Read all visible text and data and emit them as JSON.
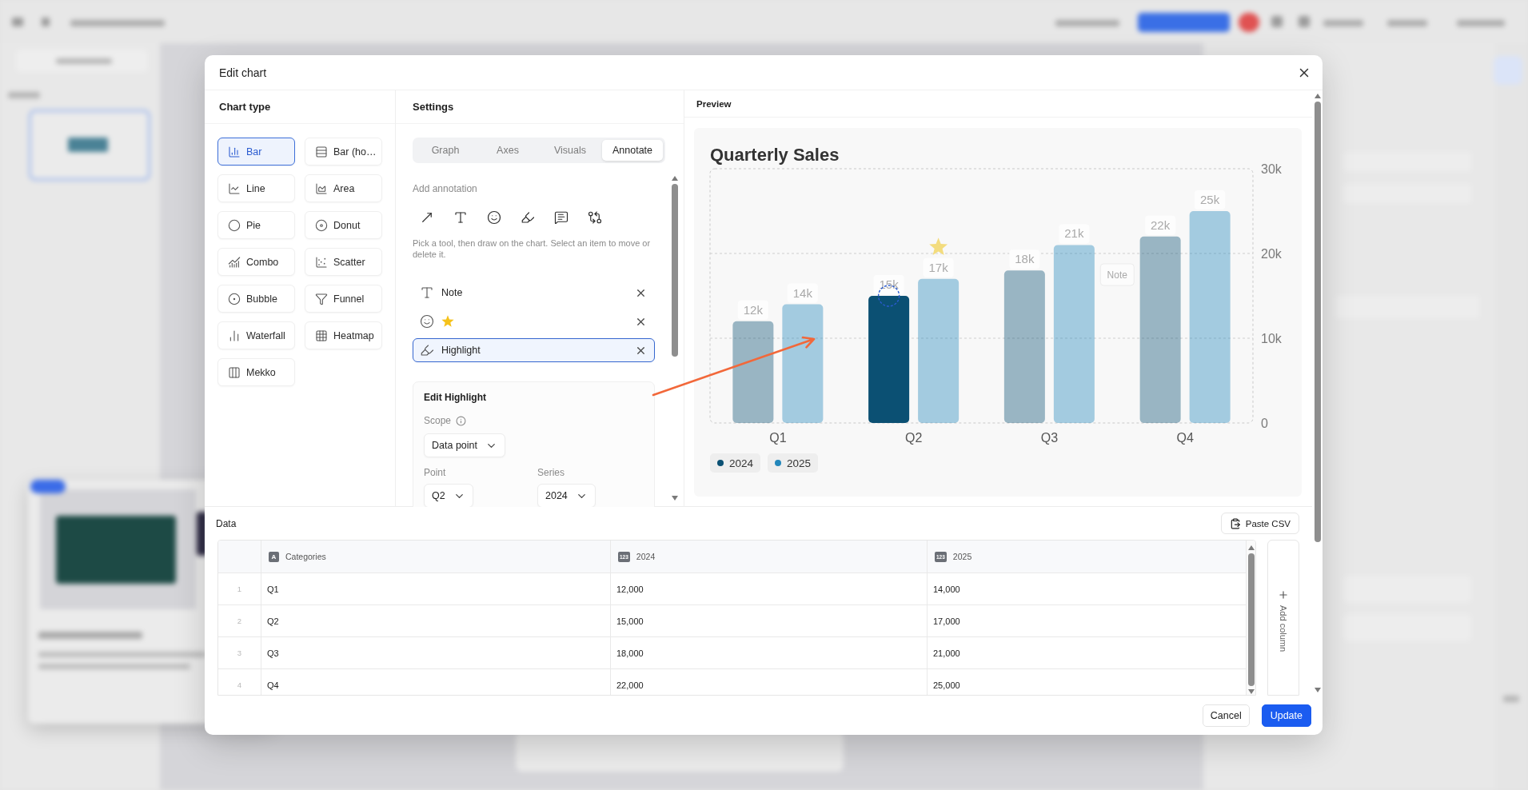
{
  "dialog": {
    "title": "Edit chart"
  },
  "chart_type": {
    "heading": "Chart type",
    "items": [
      {
        "label": "Bar",
        "selected": true
      },
      {
        "label": "Bar (ho…",
        "selected": false
      },
      {
        "label": "Line",
        "selected": false
      },
      {
        "label": "Area",
        "selected": false
      },
      {
        "label": "Pie",
        "selected": false
      },
      {
        "label": "Donut",
        "selected": false
      },
      {
        "label": "Combo",
        "selected": false
      },
      {
        "label": "Scatter",
        "selected": false
      },
      {
        "label": "Bubble",
        "selected": false
      },
      {
        "label": "Funnel",
        "selected": false
      },
      {
        "label": "Waterfall",
        "selected": false
      },
      {
        "label": "Heatmap",
        "selected": false
      },
      {
        "label": "Mekko",
        "selected": false
      }
    ]
  },
  "settings": {
    "heading": "Settings",
    "tabs": [
      {
        "label": "Graph",
        "selected": false
      },
      {
        "label": "Axes",
        "selected": false
      },
      {
        "label": "Visuals",
        "selected": false
      },
      {
        "label": "Annotate",
        "selected": true
      }
    ],
    "add_annotation": "Add annotation",
    "hint": "Pick a tool, then draw on the chart. Select an item to move or delete it.",
    "annotations": [
      {
        "kind": "text",
        "label": "Note",
        "selected": false
      },
      {
        "kind": "emoji",
        "selected": false
      },
      {
        "kind": "highlight",
        "label": "Highlight",
        "selected": true
      }
    ],
    "editor": {
      "title": "Edit Highlight",
      "scope": {
        "label": "Scope",
        "value": "Data point"
      },
      "point": {
        "label": "Point",
        "value": "Q2"
      },
      "series": {
        "label": "Series",
        "value": "2024"
      }
    }
  },
  "preview": {
    "heading": "Preview",
    "chart_data": {
      "type": "bar",
      "title": "Quarterly Sales",
      "categories": [
        "Q1",
        "Q2",
        "Q3",
        "Q4"
      ],
      "series": [
        {
          "name": "2024",
          "color": "#0b5073",
          "values": [
            12000,
            15000,
            18000,
            22000
          ]
        },
        {
          "name": "2025",
          "color": "#2387bb",
          "values": [
            14000,
            17000,
            21000,
            25000
          ]
        }
      ],
      "ylim": [
        0,
        30000
      ],
      "yticks": [
        {
          "value": 0,
          "label": "0"
        },
        {
          "value": 10000,
          "label": "10k"
        },
        {
          "value": 20000,
          "label": "20k"
        },
        {
          "value": 30000,
          "label": "30k"
        }
      ],
      "value_labels": [
        [
          "12k",
          "15k",
          "18k",
          "22k"
        ],
        [
          "14k",
          "17k",
          "21k",
          "25k"
        ]
      ],
      "legend": "bottom"
    },
    "series_marks": [
      {
        "highlighted": [
          false,
          true,
          false,
          false
        ],
        "emoji": [
          false,
          false,
          false,
          false
        ]
      },
      {
        "highlighted": [
          false,
          false,
          false,
          false
        ],
        "emoji": [
          false,
          true,
          false,
          false
        ]
      }
    ],
    "note": "Note",
    "arrow": true
  },
  "data": {
    "heading": "Data",
    "paste_button": "Paste CSV",
    "columns": [
      {
        "type_badge": "A",
        "label": "Categories"
      },
      {
        "type_badge": "123",
        "label": "2024"
      },
      {
        "type_badge": "123",
        "label": "2025"
      }
    ],
    "rows": [
      {
        "number": "1",
        "cells": [
          "Q1",
          "12,000",
          "14,000"
        ]
      },
      {
        "number": "2",
        "cells": [
          "Q2",
          "15,000",
          "17,000"
        ]
      },
      {
        "number": "3",
        "cells": [
          "Q3",
          "18,000",
          "21,000"
        ]
      },
      {
        "number": "4",
        "cells": [
          "Q4",
          "22,000",
          "25,000"
        ]
      }
    ],
    "add_column": "Add column"
  },
  "footer": {
    "buttons": [
      {
        "label": "Cancel",
        "kind": "secondary"
      },
      {
        "label": "Update",
        "kind": "primary"
      }
    ]
  }
}
